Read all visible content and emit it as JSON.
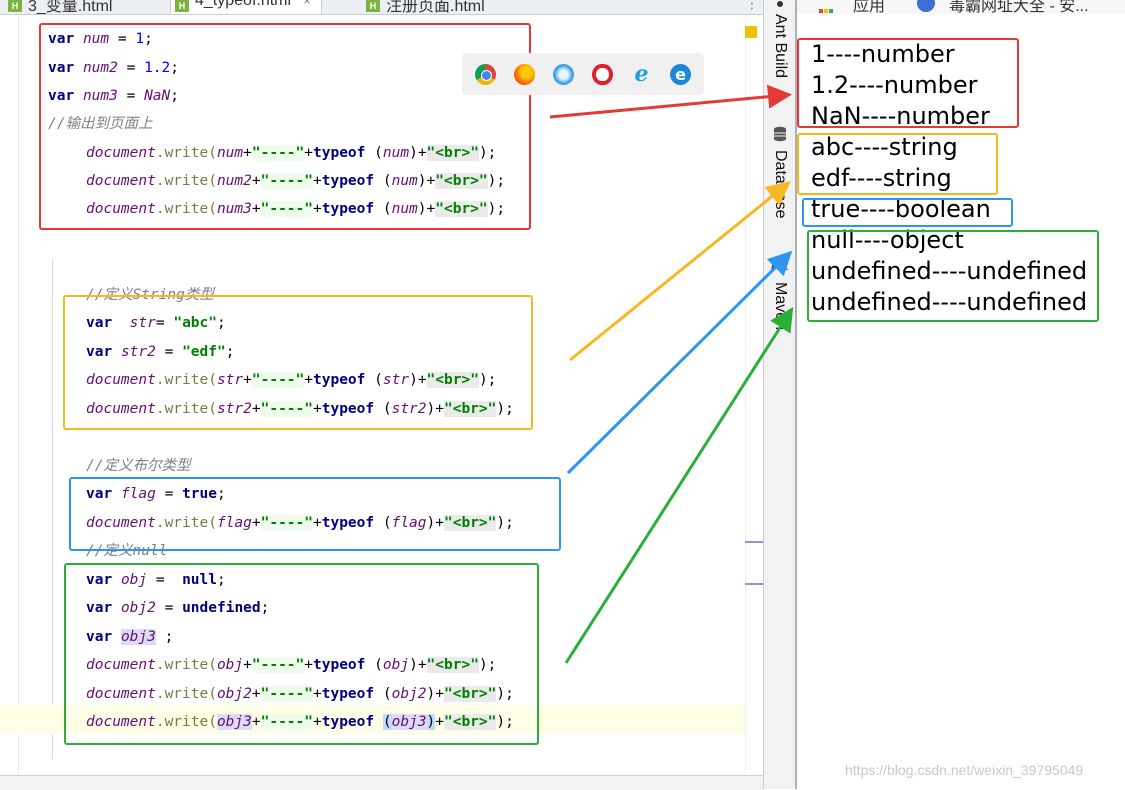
{
  "tabs": [
    {
      "label": "3_变量.html"
    },
    {
      "label": "4_typeof.html",
      "close": "×"
    },
    {
      "label": "注册页面.html"
    }
  ],
  "tab_icon": "H",
  "code": {
    "red": [
      {
        "kw": "var",
        "name": "num",
        "op": " = ",
        "val": "1",
        ";": ";"
      },
      {
        "kw": "var",
        "name": "num2",
        "op": " = ",
        "val": "1.2"
      },
      {
        "kw": "var",
        "name": "num3",
        "op": " = ",
        "val": "NaN"
      }
    ],
    "comment_output": "//输出到页面上",
    "comment_string": "//定义String类型",
    "comment_bool": "//定义布尔类型",
    "comment_null": "//定义null",
    "doc": "document",
    "write": ".write(",
    "sep": "\"----\"",
    "plus": "+",
    "typeof": "typeof",
    "br": "\"<br>\"",
    "str_abc": "\"abc\"",
    "str_edf": "\"edf\"",
    "kw_var": "var",
    "kw_true": "true",
    "kw_null": "null",
    "kw_undefined": "undefined",
    "num_1": "1",
    "num_12": "1.2",
    "nan": "NaN",
    "n_num": "num",
    "n_num2": "num2",
    "n_num3": "num3",
    "n_str": "str",
    "n_str2": "str2",
    "n_flag": "flag",
    "n_obj": "obj",
    "n_obj2": "obj2",
    "n_obj3": "obj3"
  },
  "toolstrip": {
    "ant_build": "Ant Build",
    "database": "Database",
    "maven": "Maven"
  },
  "bookmarks": {
    "apps": "应用",
    "site": "毒霸网址大全 - 安..."
  },
  "output_lines": [
    "1----number",
    "1.2----number",
    "NaN----number",
    "abc----string",
    "edf----string",
    "true----boolean",
    "null----object",
    "undefined----undefined",
    "undefined----undefined"
  ],
  "watermark": "https://blog.csdn.net/weixin_39795049",
  "colors": {
    "red": "#e53935",
    "orange": "#f6b820",
    "blue": "#2d97f0",
    "green": "#2cae3a"
  },
  "browser_icons": [
    "chrome-icon",
    "firefox-icon",
    "safari-icon",
    "opera-icon",
    "ie-icon",
    "edge-icon"
  ]
}
